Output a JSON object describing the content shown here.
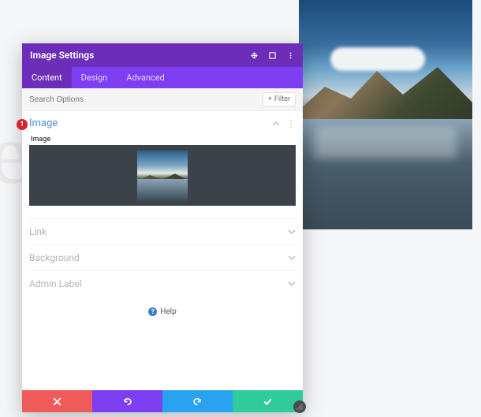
{
  "modal": {
    "title": "Image Settings",
    "tabs": [
      "Content",
      "Design",
      "Advanced"
    ],
    "active_tab": 0,
    "search_placeholder": "Search Options",
    "filter_label": "Filter"
  },
  "badge": {
    "count": "1"
  },
  "sections": {
    "image": {
      "title": "Image",
      "field_label": "Image"
    },
    "link": {
      "title": "Link"
    },
    "background": {
      "title": "Background"
    },
    "admin_label": {
      "title": "Admin Label"
    }
  },
  "help": {
    "label": "Help"
  },
  "footer": {
    "cancel_icon": "close",
    "undo_icon": "undo",
    "redo_icon": "redo",
    "save_icon": "check"
  }
}
